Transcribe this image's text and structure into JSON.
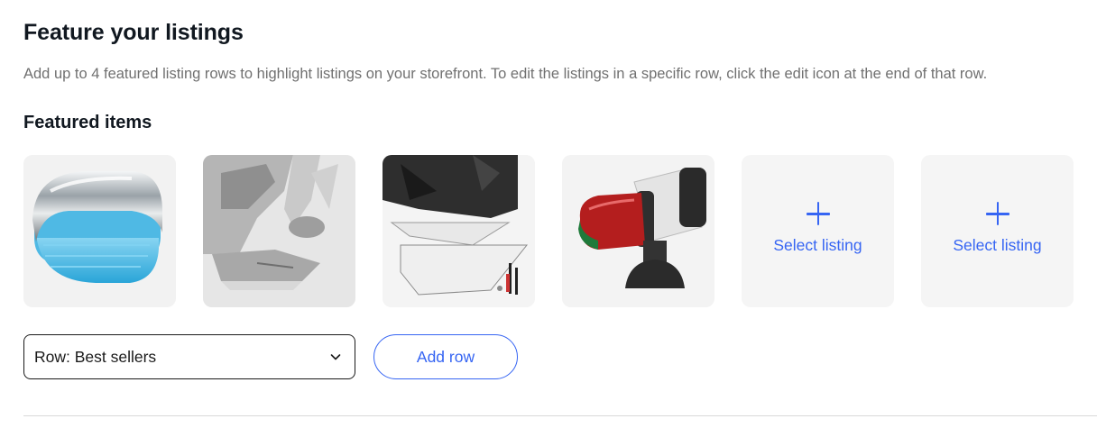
{
  "header": {
    "title": "Feature your listings",
    "description": "Add up to 4 featured listing rows to highlight listings on your storefront. To edit the listings in a specific row, click the edit icon at the end of that row."
  },
  "featured": {
    "subtitle": "Featured items",
    "items": [
      {
        "icon": "blue-led-courtesy-light"
      },
      {
        "icon": "outboard-motor-skeg"
      },
      {
        "icon": "trim-tab-plates"
      },
      {
        "icon": "bi-color-navigation-light"
      }
    ],
    "empty_slots": [
      {
        "label": "Select listing"
      },
      {
        "label": "Select listing"
      }
    ]
  },
  "controls": {
    "row_select_value": "Row: Best sellers",
    "add_row_label": "Add row"
  },
  "colors": {
    "accent": "#3665f3",
    "tile_bg": "#f2f2f2",
    "text": "#191919",
    "muted": "#707070"
  }
}
